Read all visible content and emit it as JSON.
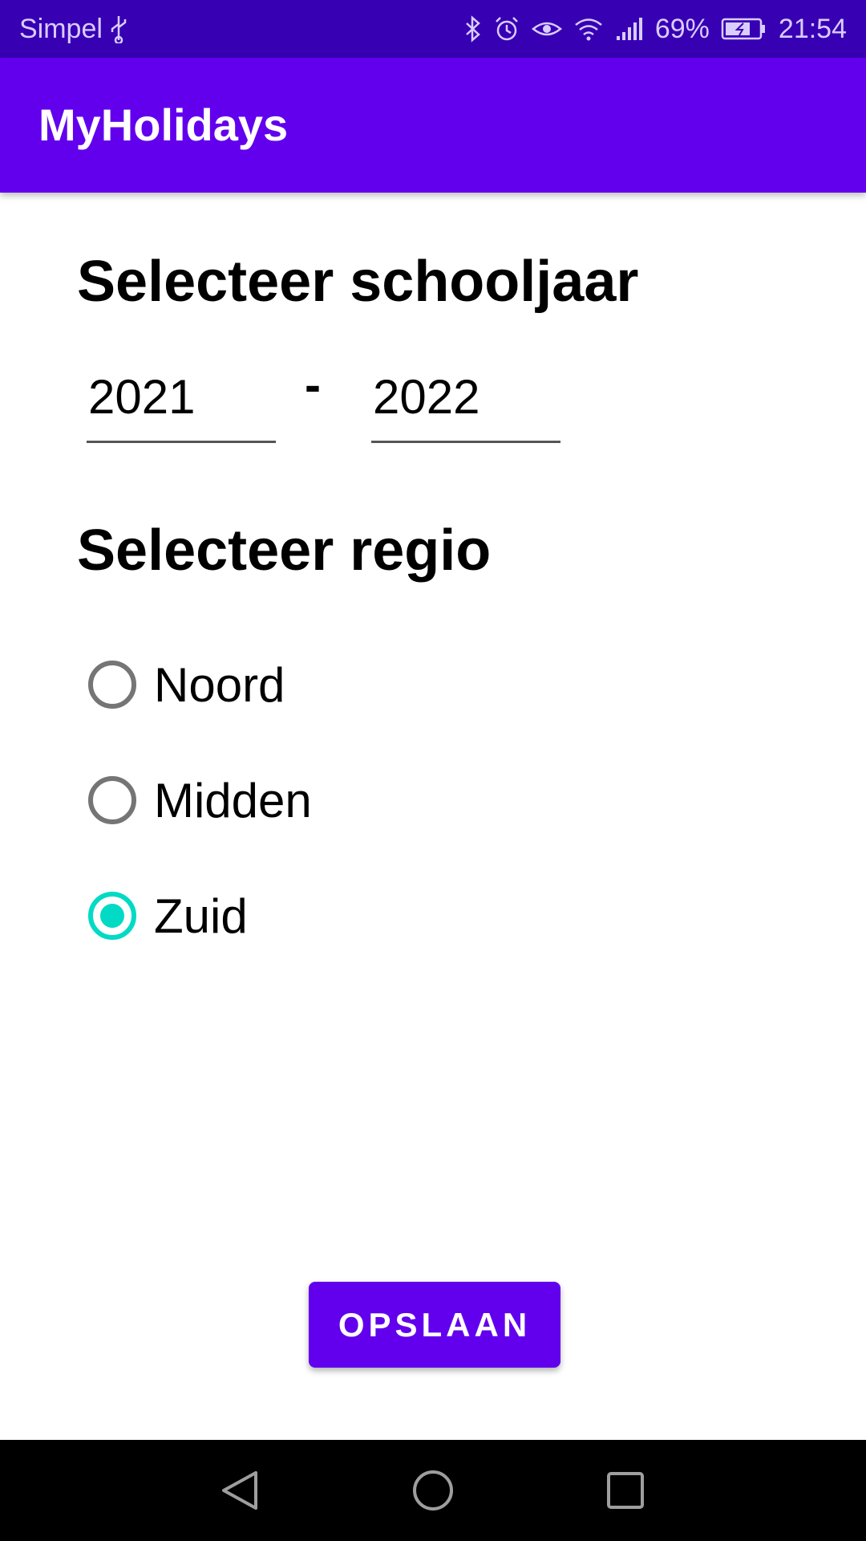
{
  "status_bar": {
    "carrier": "Simpel",
    "battery": "69%",
    "time": "21:54",
    "icons": [
      "usb-icon",
      "bluetooth-icon",
      "alarm-icon",
      "eye-icon",
      "wifi-icon",
      "signal-icon",
      "battery-charging-icon"
    ]
  },
  "app_bar": {
    "title": "MyHolidays"
  },
  "school_year": {
    "heading": "Selecteer schooljaar",
    "start": "2021",
    "separator": "-",
    "end": "2022"
  },
  "region": {
    "heading": "Selecteer regio",
    "options": [
      {
        "label": "Noord",
        "selected": false
      },
      {
        "label": "Midden",
        "selected": false
      },
      {
        "label": "Zuid",
        "selected": true
      }
    ]
  },
  "actions": {
    "save_label": "OPSLAAN"
  },
  "colors": {
    "primary": "#6200ee",
    "primary_dark": "#3700b3",
    "accent": "#03dac5"
  },
  "nav_bar": {
    "icons": [
      "back-icon",
      "home-icon",
      "recents-icon"
    ]
  }
}
